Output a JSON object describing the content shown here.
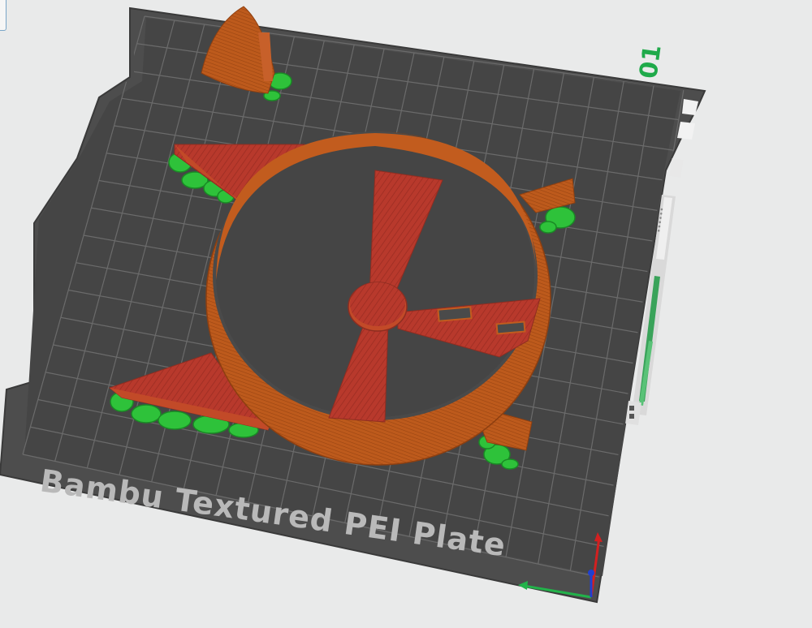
{
  "plate": {
    "label": "Bambu Textured PEI Plate",
    "number": "01"
  },
  "layer_slider": {
    "top_value": "",
    "progress_fraction": 0.55
  },
  "colors": {
    "bed": "#4a4a4a",
    "grid": "#6a6a6a",
    "wall": "#b6541a",
    "fill": "#b2372a",
    "support": "#2ec23a",
    "accent": "#1faa4a"
  },
  "icons": [
    "settings-icon",
    "layers-icon",
    "axis-z-icon",
    "axis-x-icon",
    "axis-y-icon"
  ]
}
